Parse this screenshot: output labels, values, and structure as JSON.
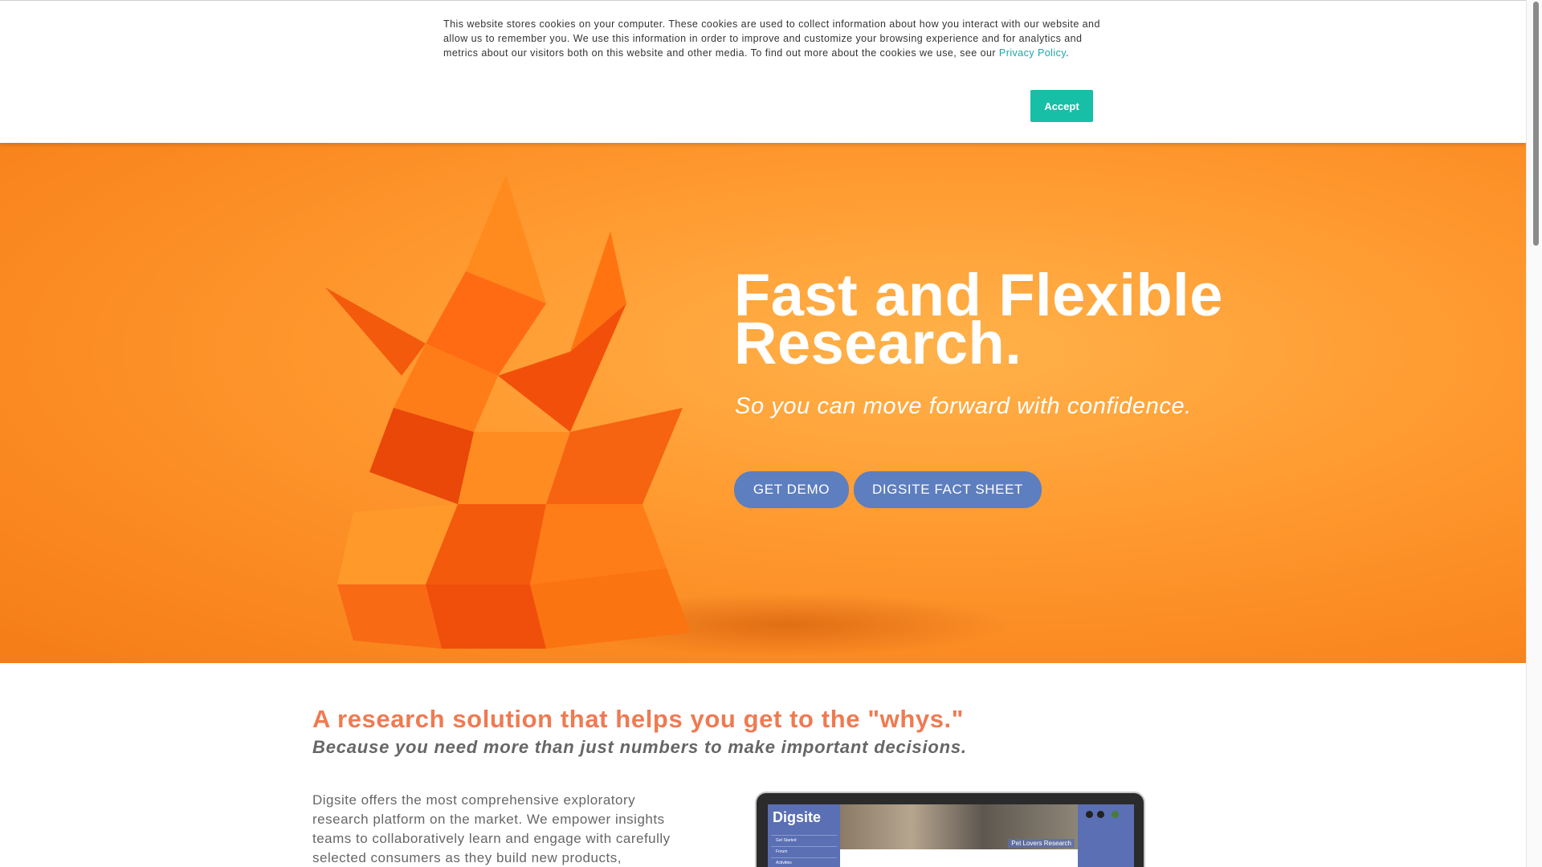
{
  "cookie_banner": {
    "text": "This website stores cookies on your computer. These cookies are used to collect information about how you interact with our website and allow us to remember you. We use this information in order to improve and customize your browsing experience and for analytics and metrics about our visitors both on this website and other media. To find out more about the cookies we use, see our",
    "link_label": "Privacy Policy",
    "trailing": ".",
    "accept_label": "Accept"
  },
  "hero": {
    "title_line1": "Fast and Flexible",
    "title_line2": "Research.",
    "subtitle": "So you can move forward with confidence.",
    "buttons": [
      {
        "label": "GET DEMO"
      },
      {
        "label": "DIGSITE FACT SHEET"
      }
    ]
  },
  "content": {
    "title": "A research solution that helps you get to the \"whys.\"",
    "subtitle": "Because you need more than just numbers to make important decisions.",
    "body": "Digsite offers the most comprehensive exploratory research platform on the market. We empower insights teams to collaboratively learn and engage with carefully selected consumers as they build new products,"
  },
  "laptop": {
    "logo": "Digsite",
    "menu": [
      "Get Started",
      "Forum",
      "Activities"
    ],
    "banner_label": "Pet Lovers Research"
  },
  "colors": {
    "accent_teal": "#17bfa7",
    "hero_orange": "#fb8a22",
    "button_blue": "#5d7ebf",
    "heading_coral": "#ef7a52"
  }
}
